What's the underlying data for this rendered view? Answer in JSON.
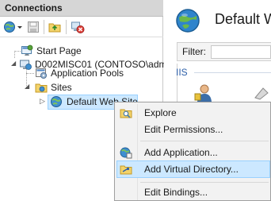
{
  "connections": {
    "title": "Connections",
    "toolbar": [
      "connect-icon",
      "dropdown-arrow-icon",
      "save-icon",
      "up-folder-icon",
      "disconnect-icon"
    ],
    "tree": {
      "start_page": "Start Page",
      "server": "D002MISC01 (CONTOSO\\adm",
      "app_pools": "Application Pools",
      "sites": "Sites",
      "default_site": "Default Web Site"
    }
  },
  "main": {
    "title": "Default W",
    "filter_label": "Filter:",
    "group_label": "IIS"
  },
  "context_menu": {
    "items": [
      "Explore",
      "Edit Permissions...",
      "Add Application...",
      "Add Virtual Directory...",
      "Edit Bindings..."
    ],
    "highlighted_index": 3
  },
  "colors": {
    "selection": "#cce8ff",
    "selection_border": "#99d1ff",
    "header": "#d6d6d6"
  }
}
